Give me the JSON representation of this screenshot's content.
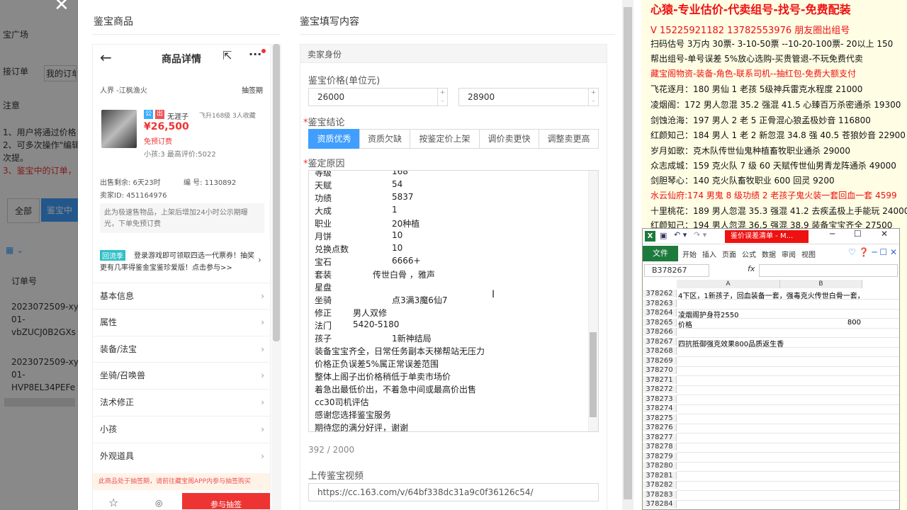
{
  "background": {
    "lines": [
      "宝广场",
      "接订单",
      "我的订单",
      "注意",
      "1、用户将通过价格",
      "2、可多次操作\"编辑",
      "次提。",
      "3、鉴宝中的订单，",
      "全部",
      "鉴宝中",
      "订单号",
      "2023072509-xy2",
      "01-",
      "vbZUCJ0B2GXs",
      "2023072509-xy2",
      "01-",
      "HVP8EL34PEFe"
    ]
  },
  "dialog": {
    "left_title": "鉴宝商品",
    "right_title": "鉴宝填写内容"
  },
  "phone": {
    "header_title": "商品详情",
    "server": "人界 -江枫渔火",
    "draw_tag": "抽签期",
    "badge1": "公",
    "badge2": "出",
    "char_name": "无涯子",
    "char_meta": "飞升168级  3人收藏",
    "price": "¥26,500",
    "free_order": "免预订费",
    "child_info": "小孩:3 最高评价:5022",
    "remaining": "出售剩余: 6天23时",
    "id_label": "编 号: 1130892",
    "seller_id": "卖家ID: 451164976",
    "notice": "此为极速售物品，上架后增加24小时公示期曝光，下单免预订费",
    "promo_tag": "回流季",
    "promo_text": "登录游戏即可领取四选一代票券！抽奖更有几率得鉴金宝鉴珍爱版！点击参与>>",
    "menu": [
      "基本信息",
      "属性",
      "装备/法宝",
      "坐骑/召唤兽",
      "法术修正",
      "小孩",
      "外观道具"
    ],
    "footer_notice": "此商品处于抽签期，请前往藏宝阁APP内参与抽签购买",
    "buy_btn": "参与抽签"
  },
  "form": {
    "seller_identity": "卖家身份",
    "price_label": "鉴宝价格(单位元)",
    "price_min": "26000",
    "price_max": "28900",
    "conclusion_label": "鉴宝结论",
    "tabs": [
      "资质优秀",
      "资质欠缺",
      "按鉴定价上架",
      "调价卖更快",
      "调整卖更高"
    ],
    "reason_label": "鉴定原因",
    "reason_rows": [
      {
        "k": "等级",
        "v": "168"
      },
      {
        "k": "天赋",
        "v": "54"
      },
      {
        "k": "功绩",
        "v": "5837"
      },
      {
        "k": "大成",
        "v": "1"
      },
      {
        "k": "职业",
        "v": "20种植"
      },
      {
        "k": "月饼",
        "v": "10"
      },
      {
        "k": "兑换点数",
        "v": "10"
      },
      {
        "k": "宝石",
        "v": "6666+"
      },
      {
        "k": "套装",
        "v": "传世白骨 ，雅声"
      },
      {
        "k": "星盘",
        "v": ""
      },
      {
        "k": "坐骑",
        "v": "点3满3魔6仙7"
      },
      {
        "k": "修正",
        "v": "男人双修"
      },
      {
        "k": "法门",
        "v": "5420-5180"
      },
      {
        "k": "孩子",
        "v": "1新神结局"
      }
    ],
    "reason_lines": [
      "装备宝宝齐全，日常任务副本天梯帮站无压力",
      "价格正负误差5%属正常误差范围",
      "整体上阁子出价格稍低于单卖市场价",
      "着急出最低价出，不着急中间或最高价出售",
      "cc30司机评估",
      "感谢您选择鉴宝服务",
      "期待您的满分好评，谢谢"
    ],
    "counter": "392 / 2000",
    "video_label": "上传鉴宝视频",
    "video_url": "https://cc.163.com/v/64bf338dc31a9c0f36126c54/"
  },
  "right_panel": {
    "title": "心猿-专业估价-代卖组号-找号-免费配装",
    "lines": [
      {
        "t": "V 15225921182   13782553976 朋友圈出组号",
        "c": "#e11"
      },
      {
        "t": "扫码估号 3万内 30票- 3-10-50票  --10-20-100票- 20以上 150",
        "c": "#111"
      },
      {
        "t": "帮出组号-单号误差 5%放心选购-买贵管退-不玩免费代卖",
        "c": "#111"
      },
      {
        "t": "藏宝阁物资-装备-角色-联系司机--抽红包-免费大额支付",
        "c": "#e11"
      },
      {
        "t": "飞花逐月：180 男仙 1 老孩 5级神兵雷克水程度 21000",
        "c": "#111"
      },
      {
        "t": "凌烟阁：172 男人忽混 35.2 强混 41.5 心臻百万杀密通杀 19300",
        "c": "#111"
      },
      {
        "t": "剑蚀沧海：197 男人 2 老 5 正骨混心狼孟极妙音 116800",
        "c": "#111"
      },
      {
        "t": "红颜知己：184 男人 1 老 2 新忽混 34.8 强 40.5 苍狼妙音 22900",
        "c": "#111"
      },
      {
        "t": "岁月如歌：克木队传世仙鬼种植畜牧职业通杀 29000",
        "c": "#111"
      },
      {
        "t": "众志成城：159 克火队 7 级 60 天赋传世仙男青龙阵通杀 49000",
        "c": "#111"
      },
      {
        "t": "剑胆琴心：140 克火队畜牧职业 600 回灵 9200",
        "c": "#111"
      },
      {
        "t": "水云仙府:174 男鬼 8 级功绩 2 老孩子鬼火装一套回血一套 4599",
        "c": "#e11"
      },
      {
        "t": "十里桃花：189 男人忽混 35.3 强混 41.2 去疾孟极上手能玩 24000",
        "c": "#111"
      },
      {
        "t": "红颜知己：194 男人忽混 36.5 强混 38.9 装备宝宝齐全 27500",
        "c": "#111"
      }
    ]
  },
  "excel": {
    "title": "鉴价误差清单 - M...",
    "file_btn": "文件",
    "ribbon": [
      "开始",
      "插入",
      "页面",
      "公式",
      "数据",
      "审阅",
      "视图"
    ],
    "name_box": "B378267",
    "fx": "fx",
    "col_a": "A",
    "col_b": "B",
    "rows": [
      {
        "n": "378262",
        "a": "4下区，1新孩子，回血装备一套，强毒克火传世白骨一套，",
        "b": ""
      },
      {
        "n": "378263",
        "a": "",
        "b": ""
      },
      {
        "n": "378264",
        "a": "凌烟阁护身符2550",
        "b": ""
      },
      {
        "n": "378265",
        "a": "价格",
        "b": "800"
      },
      {
        "n": "378266",
        "a": "",
        "b": ""
      },
      {
        "n": "378267",
        "a": "四抗抵御强克效果800品质返生香",
        "b": ""
      },
      {
        "n": "378268",
        "a": "",
        "b": ""
      },
      {
        "n": "378269",
        "a": "",
        "b": ""
      },
      {
        "n": "378270",
        "a": "",
        "b": ""
      },
      {
        "n": "378271",
        "a": "",
        "b": ""
      },
      {
        "n": "378272",
        "a": "",
        "b": ""
      },
      {
        "n": "378273",
        "a": "",
        "b": ""
      },
      {
        "n": "378274",
        "a": "",
        "b": ""
      },
      {
        "n": "378275",
        "a": "",
        "b": ""
      },
      {
        "n": "378276",
        "a": "",
        "b": ""
      },
      {
        "n": "378277",
        "a": "",
        "b": ""
      },
      {
        "n": "378278",
        "a": "",
        "b": ""
      },
      {
        "n": "378279",
        "a": "",
        "b": ""
      },
      {
        "n": "378280",
        "a": "",
        "b": ""
      },
      {
        "n": "378281",
        "a": "",
        "b": ""
      },
      {
        "n": "378282",
        "a": "",
        "b": ""
      },
      {
        "n": "378283",
        "a": "",
        "b": ""
      },
      {
        "n": "378284",
        "a": "",
        "b": ""
      }
    ]
  }
}
